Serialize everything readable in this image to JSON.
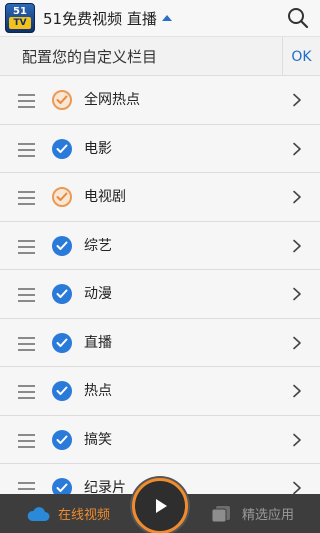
{
  "appbar": {
    "logo_top": "51",
    "logo_bottom": "TV",
    "title": "51免费视频 直播",
    "search_icon": "search-icon"
  },
  "subbar": {
    "title": "配置您的自定义栏目",
    "ok_label": "OK"
  },
  "columns": [
    {
      "label": "全网热点",
      "state": "partial"
    },
    {
      "label": "电影",
      "state": "checked"
    },
    {
      "label": "电视剧",
      "state": "partial"
    },
    {
      "label": "综艺",
      "state": "checked"
    },
    {
      "label": "动漫",
      "state": "checked"
    },
    {
      "label": "直播",
      "state": "checked"
    },
    {
      "label": "热点",
      "state": "checked"
    },
    {
      "label": "搞笑",
      "state": "checked"
    },
    {
      "label": "纪录片",
      "state": "checked"
    }
  ],
  "bottom_nav": {
    "left_label": "在线视频",
    "right_label": "精选应用",
    "left_icon": "cloud-icon",
    "center_icon": "play-icon",
    "right_icon": "apps-icon"
  },
  "colors": {
    "accent": "#2a7ad9",
    "orange": "#f08b2e",
    "bar": "#3d3d3d"
  }
}
